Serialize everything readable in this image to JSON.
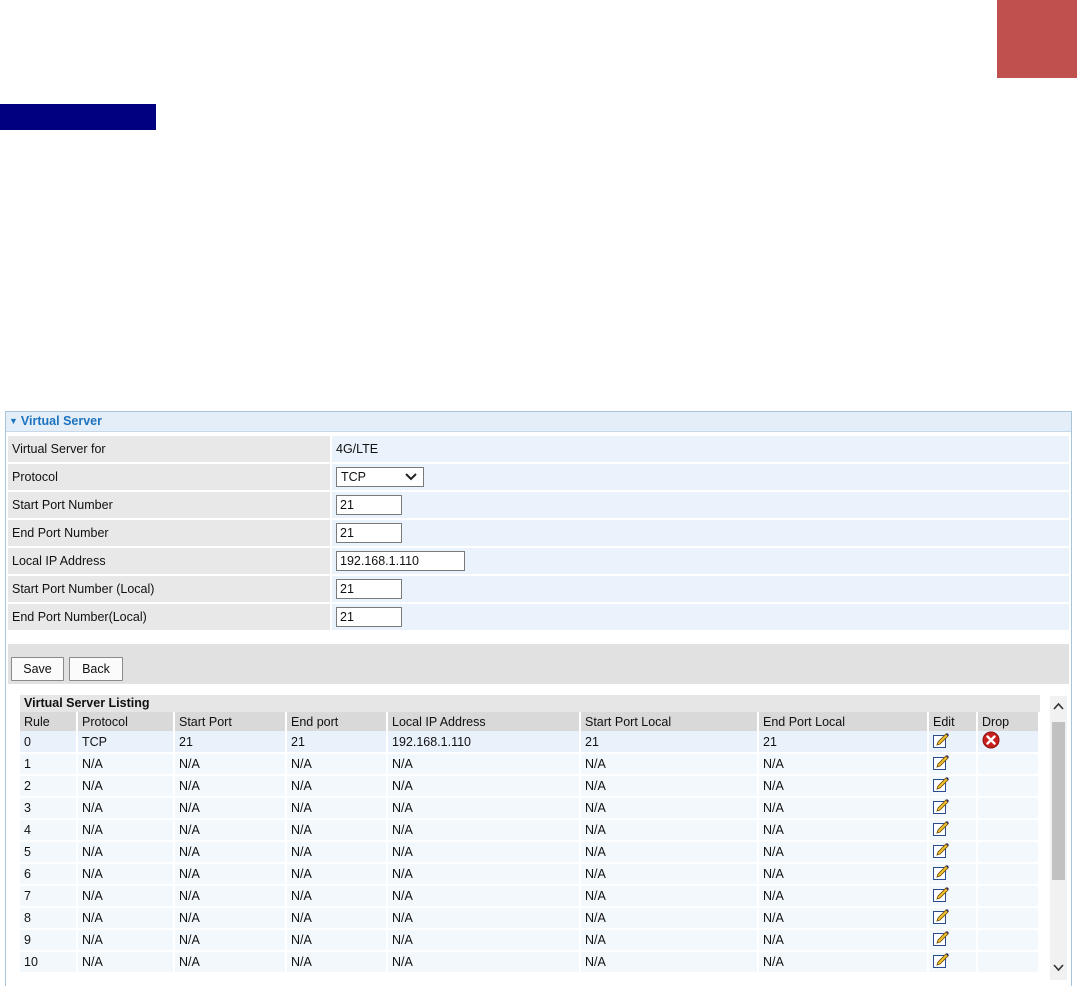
{
  "colors": {
    "corner_block": "#c0504d",
    "navy_bar": "#000080",
    "header_text": "#1e73be"
  },
  "panel": {
    "title": "Virtual Server",
    "collapse_icon": "triangle-down-icon"
  },
  "form": {
    "rows": [
      {
        "label": "Virtual Server for",
        "value": "4G/LTE"
      },
      {
        "label": "Protocol",
        "value": "TCP"
      },
      {
        "label": "Start Port Number",
        "value": "21"
      },
      {
        "label": "End Port Number",
        "value": "21"
      },
      {
        "label": "Local IP Address",
        "value": "192.168.1.110"
      },
      {
        "label": "Start Port Number (Local)",
        "value": "21"
      },
      {
        "label": "End Port Number(Local)",
        "value": "21"
      }
    ]
  },
  "buttons": {
    "save": "Save",
    "back": "Back"
  },
  "listing": {
    "title": "Virtual Server Listing",
    "columns": [
      "Rule",
      "Protocol",
      "Start Port",
      "End port",
      "Local IP Address",
      "Start Port Local",
      "End Port Local",
      "Edit",
      "Drop"
    ],
    "rows": [
      {
        "rule": "0",
        "protocol": "TCP",
        "start_port": "21",
        "end_port": "21",
        "local_ip": "192.168.1.110",
        "start_local": "21",
        "end_local": "21"
      },
      {
        "rule": "1",
        "protocol": "N/A",
        "start_port": "N/A",
        "end_port": "N/A",
        "local_ip": "N/A",
        "start_local": "N/A",
        "end_local": "N/A"
      },
      {
        "rule": "2",
        "protocol": "N/A",
        "start_port": "N/A",
        "end_port": "N/A",
        "local_ip": "N/A",
        "start_local": "N/A",
        "end_local": "N/A"
      },
      {
        "rule": "3",
        "protocol": "N/A",
        "start_port": "N/A",
        "end_port": "N/A",
        "local_ip": "N/A",
        "start_local": "N/A",
        "end_local": "N/A"
      },
      {
        "rule": "4",
        "protocol": "N/A",
        "start_port": "N/A",
        "end_port": "N/A",
        "local_ip": "N/A",
        "start_local": "N/A",
        "end_local": "N/A"
      },
      {
        "rule": "5",
        "protocol": "N/A",
        "start_port": "N/A",
        "end_port": "N/A",
        "local_ip": "N/A",
        "start_local": "N/A",
        "end_local": "N/A"
      },
      {
        "rule": "6",
        "protocol": "N/A",
        "start_port": "N/A",
        "end_port": "N/A",
        "local_ip": "N/A",
        "start_local": "N/A",
        "end_local": "N/A"
      },
      {
        "rule": "7",
        "protocol": "N/A",
        "start_port": "N/A",
        "end_port": "N/A",
        "local_ip": "N/A",
        "start_local": "N/A",
        "end_local": "N/A"
      },
      {
        "rule": "8",
        "protocol": "N/A",
        "start_port": "N/A",
        "end_port": "N/A",
        "local_ip": "N/A",
        "start_local": "N/A",
        "end_local": "N/A"
      },
      {
        "rule": "9",
        "protocol": "N/A",
        "start_port": "N/A",
        "end_port": "N/A",
        "local_ip": "N/A",
        "start_local": "N/A",
        "end_local": "N/A"
      },
      {
        "rule": "10",
        "protocol": "N/A",
        "start_port": "N/A",
        "end_port": "N/A",
        "local_ip": "N/A",
        "start_local": "N/A",
        "end_local": "N/A"
      }
    ],
    "edit_icon": "edit-pencil-icon",
    "drop_icon": "delete-x-icon"
  }
}
